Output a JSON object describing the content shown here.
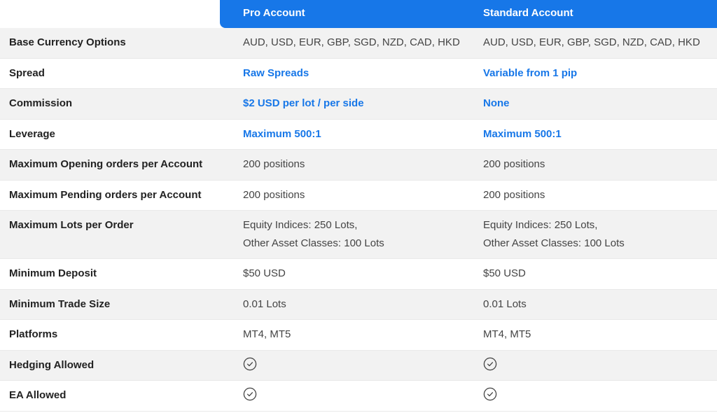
{
  "header": {
    "col1": "Pro Account",
    "col2": "Standard Account"
  },
  "colors": {
    "accent": "#1777e8",
    "row_alt": "#f2f2f2"
  },
  "rows": [
    {
      "label": "Base Currency Options",
      "pro": "AUD, USD, EUR, GBP, SGD, NZD, CAD, HKD",
      "standard": "AUD, USD, EUR, GBP, SGD, NZD, CAD, HKD"
    },
    {
      "label": "Spread",
      "pro": "Raw Spreads",
      "standard": "Variable from 1 pip"
    },
    {
      "label": "Commission",
      "pro": "$2 USD per lot / per side",
      "standard": "None"
    },
    {
      "label": "Leverage",
      "pro": "Maximum 500:1",
      "standard": "Maximum 500:1"
    },
    {
      "label": "Maximum Opening orders per Account",
      "pro": "200 positions",
      "standard": "200 positions"
    },
    {
      "label": "Maximum Pending orders per Account",
      "pro": "200 positions",
      "standard": "200 positions"
    },
    {
      "label": "Maximum Lots per Order",
      "pro_line1": "Equity Indices: 250 Lots,",
      "pro_line2": "Other Asset Classes: 100 Lots",
      "standard_line1": "Equity Indices: 250 Lots,",
      "standard_line2": "Other Asset Classes: 100 Lots"
    },
    {
      "label": "Minimum Deposit",
      "pro": "$50 USD",
      "standard": "$50 USD"
    },
    {
      "label": "Minimum Trade Size",
      "pro": "0.01 Lots",
      "standard": "0.01 Lots"
    },
    {
      "label": "Platforms",
      "pro": "MT4, MT5",
      "standard": "MT4, MT5"
    },
    {
      "label": "Hedging Allowed",
      "pro_icon": "check-circle-icon",
      "standard_icon": "check-circle-icon"
    },
    {
      "label": "EA Allowed",
      "pro_icon": "check-circle-icon",
      "standard_icon": "check-circle-icon"
    }
  ]
}
